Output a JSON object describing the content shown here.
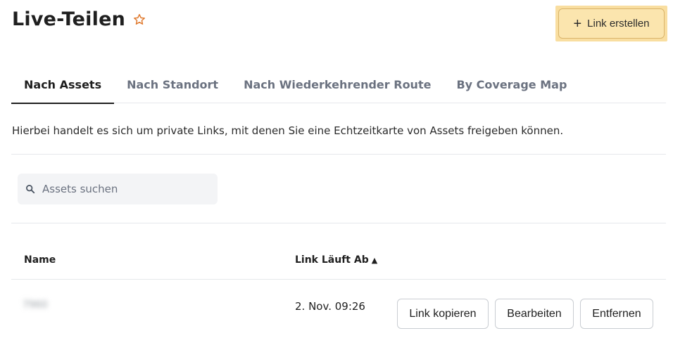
{
  "header": {
    "title": "Live-Teilen",
    "create_button_label": "Link erstellen"
  },
  "tabs": [
    {
      "label": "Nach Assets",
      "active": true
    },
    {
      "label": "Nach Standort",
      "active": false
    },
    {
      "label": "Nach Wiederkehrender Route",
      "active": false
    },
    {
      "label": "By Coverage Map",
      "active": false
    }
  ],
  "description": "Hierbei handelt es sich um private Links, mit denen Sie eine Echtzeitkarte von Assets freigeben können.",
  "search": {
    "placeholder": "Assets suchen",
    "value": ""
  },
  "table": {
    "columns": {
      "name": "Name",
      "expiry": "Link Läuft Ab",
      "sort_indicator": "▲"
    },
    "rows": [
      {
        "name": "7960",
        "expiry": "2. Nov. 09:26",
        "actions": {
          "copy": "Link kopieren",
          "edit": "Bearbeiten",
          "remove": "Entfernen"
        }
      }
    ]
  },
  "colors": {
    "accent": "#fbe5ae",
    "accent_border": "#d9b46a",
    "star": "#e07a2f"
  },
  "icons": {
    "favorite": "star-outline-icon",
    "create": "plus-icon",
    "search": "search-icon"
  }
}
